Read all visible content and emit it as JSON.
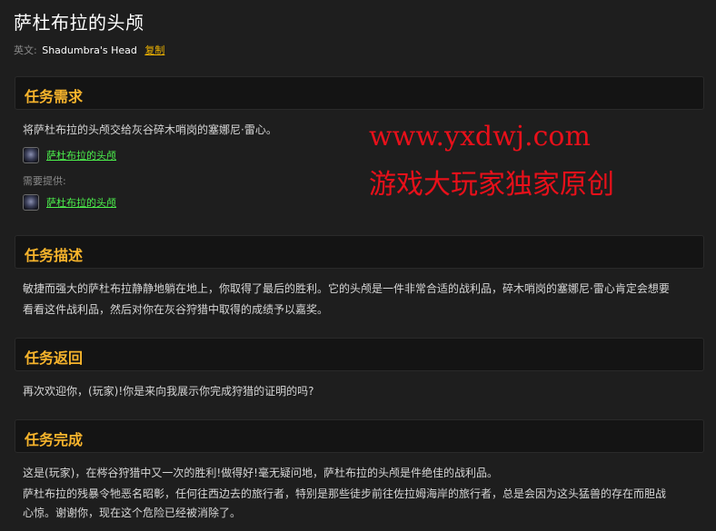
{
  "page": {
    "title": "萨杜布拉的头颅",
    "english_label": "英文:",
    "english_name": "Shadumbra's Head",
    "copy_label": "复制"
  },
  "sections": {
    "requirements": {
      "header": "任务需求",
      "text": "将萨杜布拉的头颅交给灰谷碎木哨岗的塞娜尼·雷心。",
      "item1": "萨杜布拉的头颅",
      "provided_label": "需要提供:",
      "item2": "萨杜布拉的头颅"
    },
    "description": {
      "header": "任务描述",
      "line1": "敏捷而强大的萨杜布拉静静地躺在地上，你取得了最后的胜利。它的头颅是一件非常合适的战利品，碎木哨岗的塞娜尼·雷心肯定会想要",
      "line2": "看看这件战利品，然后对你在灰谷狩猎中取得的成绩予以嘉奖。"
    },
    "return": {
      "header": "任务返回",
      "text": "再次欢迎你，(玩家)!你是来向我展示你完成狩猎的证明的吗?"
    },
    "completion": {
      "header": "任务完成",
      "line1": "这是(玩家)，在梣谷狩猎中又一次的胜利!做得好!毫无疑问地，萨杜布拉的头颅是件绝佳的战利品。",
      "line2": "萨杜布拉的残暴令牠恶名昭彰，任何往西边去的旅行者，特别是那些徒步前往佐拉姆海岸的旅行者，总是会因为这头猛兽的存在而胆战",
      "line3": "心惊。谢谢你，现在这个危险已经被消除了。"
    }
  },
  "watermark": {
    "line1": "www.yxdwj.com",
    "line2": "游戏大玩家独家原创"
  },
  "icons": {
    "item_icon": "skull-head-icon"
  },
  "colors": {
    "accent": "#f7b42c",
    "item_link": "#4cf04c",
    "copy_link": "#f0b400",
    "watermark": "#e8101a"
  }
}
